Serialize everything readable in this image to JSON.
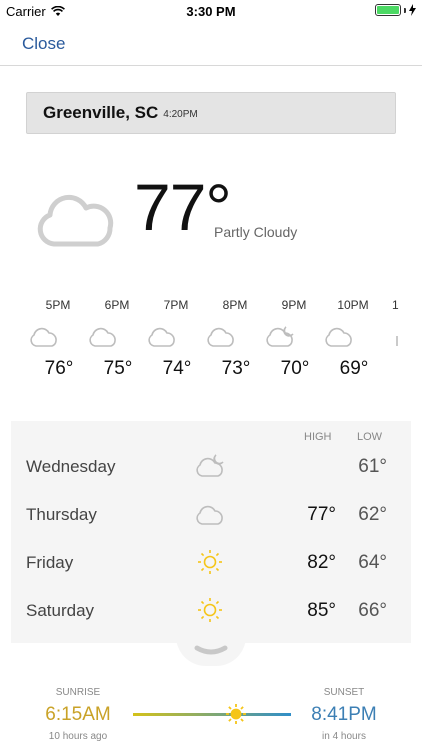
{
  "status": {
    "carrier": "Carrier",
    "time": "3:30 PM",
    "battery_level": 1.0
  },
  "nav": {
    "close_label": "Close"
  },
  "location": {
    "name": "Greenville, SC",
    "time": "4:20PM"
  },
  "current": {
    "temp": "77°",
    "condition": "Partly Cloudy",
    "icon": "cloud-icon"
  },
  "hourly": [
    {
      "time": "5PM",
      "icon": "cloud-icon",
      "temp": "76°"
    },
    {
      "time": "6PM",
      "icon": "cloud-icon",
      "temp": "75°"
    },
    {
      "time": "7PM",
      "icon": "cloud-icon",
      "temp": "74°"
    },
    {
      "time": "8PM",
      "icon": "cloud-icon",
      "temp": "73°"
    },
    {
      "time": "9PM",
      "icon": "cloud-moon-icon",
      "temp": "70°"
    },
    {
      "time": "10PM",
      "icon": "cloud-icon",
      "temp": "69°"
    },
    {
      "time": "1",
      "icon": "cloud-icon",
      "temp": ""
    }
  ],
  "daily": {
    "high_label": "HIGH",
    "low_label": "LOW",
    "days": [
      {
        "name": "Wednesday",
        "icon": "cloud-moon-icon",
        "high": "",
        "low": "61°"
      },
      {
        "name": "Thursday",
        "icon": "cloud-icon",
        "high": "77°",
        "low": "62°"
      },
      {
        "name": "Friday",
        "icon": "sun-icon",
        "high": "82°",
        "low": "64°"
      },
      {
        "name": "Saturday",
        "icon": "sun-icon",
        "high": "85°",
        "low": "66°"
      }
    ]
  },
  "sun": {
    "sunrise_label": "SUNRISE",
    "sunrise_time": "6:15AM",
    "sunrise_ago": "10 hours ago",
    "sunset_label": "SUNSET",
    "sunset_time": "8:41PM",
    "sunset_in": "in 4 hours",
    "day_progress": 0.65
  },
  "colors": {
    "accent": "#2a5a9c",
    "sun": "#f5c518",
    "sunrise": "#c9a227",
    "sunset": "#3c7fb4"
  }
}
